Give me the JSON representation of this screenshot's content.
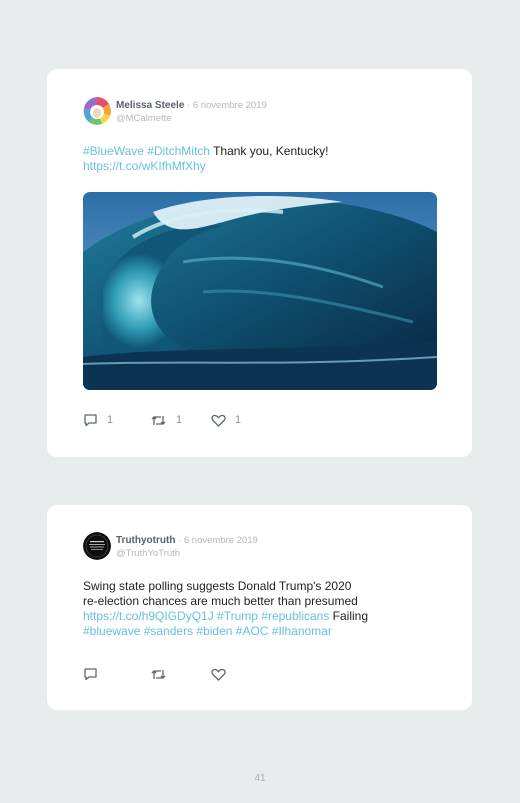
{
  "tweets": [
    {
      "name": "Melissa Steele",
      "date": " · 6 novembre 2019",
      "handle": "@MCalmette",
      "hashtag1": "#BlueWave",
      "hashtag2": "#DitchMitch",
      "text": " Thank you, Kentucky!",
      "link": "https://t.co/wKIfhMfXhy",
      "reply_count": "1",
      "retweet_count": "1",
      "like_count": "1"
    },
    {
      "name": "Truthyotruth",
      "date": " · 6 novembre 2019",
      "handle": "@TruthYoTruth",
      "line1": "Swing state polling suggests Donald Trump's 2020",
      "line2": "re-election chances are much better than presumed",
      "link": "https://t.co/h9QIGDyQ1J",
      "tag_trump": " #Trump",
      "tag_republicans": " #republicans",
      "word_failing": " Failing",
      "tag_bluewave": "#bluewave",
      "tag_sanders": " #sanders",
      "tag_biden": " #biden",
      "tag_aoc": " #AOC",
      "tag_ilhan": " #Ilhanomar"
    }
  ],
  "page_number": "41",
  "colors": {
    "link": "#66bfe0",
    "background": "#e9ecec",
    "card": "#ffffff"
  }
}
